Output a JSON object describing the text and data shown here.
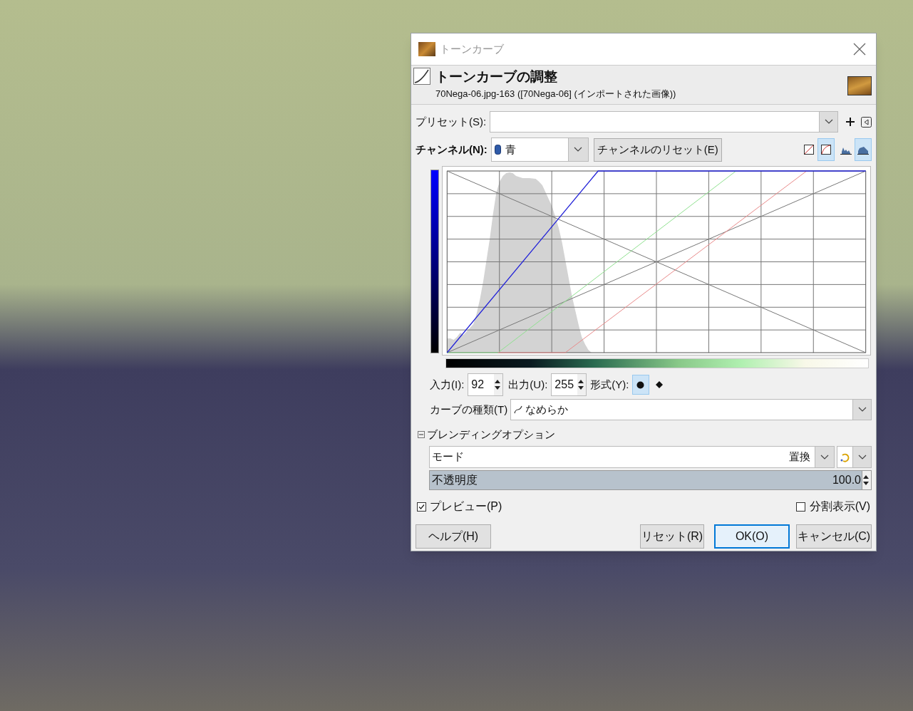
{
  "window": {
    "title": "トーンカーブ"
  },
  "header": {
    "title": "トーンカーブの調整",
    "subtitle": "70Nega-06.jpg-163 ([70Nega-06] (インポートされた画像))"
  },
  "preset": {
    "label": "プリセット(S):"
  },
  "channel": {
    "label": "チャンネル(N):",
    "value": "青",
    "reset_button": "チャンネルのリセット(E)",
    "view_buttons": [
      {
        "kind": "linear",
        "selected": false
      },
      {
        "kind": "log",
        "selected": true
      },
      {
        "kind": "linear",
        "selected": false
      },
      {
        "kind": "log",
        "selected": true
      }
    ]
  },
  "point": {
    "input_label": "入力(I):",
    "input": "92",
    "output_label": "出力(U):",
    "output": "255",
    "type_label": "形式(Y):",
    "types": [
      {
        "kind": "smooth",
        "selected": true
      },
      {
        "kind": "corner",
        "selected": false
      }
    ]
  },
  "curve_type": {
    "label": "カーブの種類(T)",
    "value": "なめらか"
  },
  "blending": {
    "title": "ブレンディングオプション",
    "expanded": true,
    "mode_label": "モード",
    "mode": "置換",
    "opacity_label": "不透明度",
    "opacity": "100.0",
    "level": 1
  },
  "preview": {
    "label": "プレビュー(P)",
    "checked": true
  },
  "split": {
    "label": "分割表示(V)",
    "checked": false
  },
  "buttons": [
    {
      "label": "ヘルプ(H)",
      "default": false
    },
    {
      "label": "リセット(R)",
      "default": false
    },
    {
      "label": "OK(O)",
      "default": true
    },
    {
      "label": "キャンセル(C)",
      "default": false
    }
  ]
}
